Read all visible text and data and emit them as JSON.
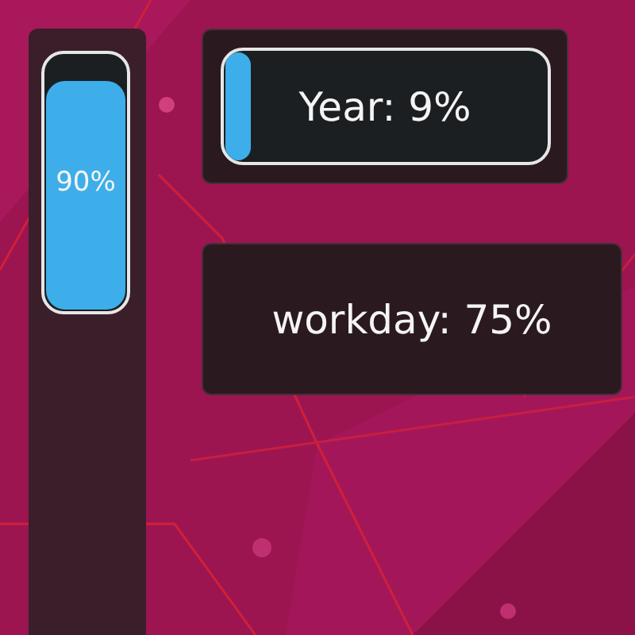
{
  "vertical_meter": {
    "label": "90%",
    "level": 0.9
  },
  "widgets": [
    {
      "kind": "bar",
      "label": "Year: 9%",
      "level": 0.09
    },
    {
      "kind": "text",
      "label": "workday: 75%"
    }
  ]
}
